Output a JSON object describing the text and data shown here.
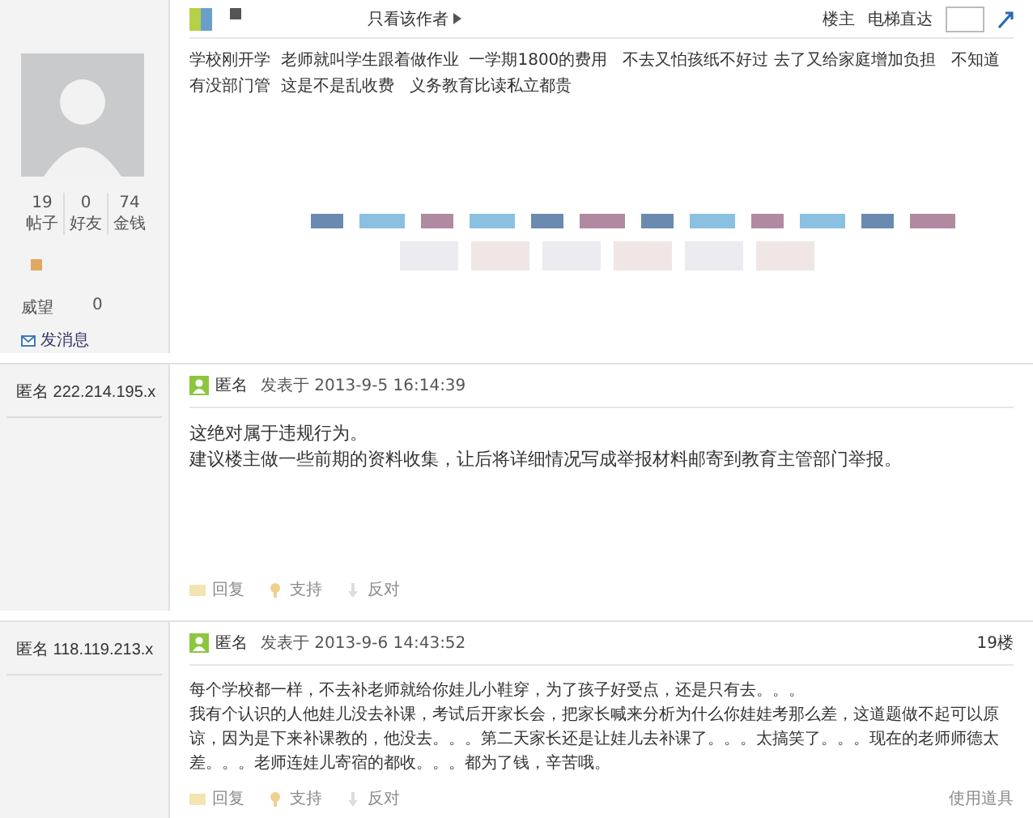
{
  "posts": [
    {
      "kind": "author",
      "author": {
        "stats": [
          {
            "value": "19",
            "label": "帖子"
          },
          {
            "value": "0",
            "label": "好友"
          },
          {
            "value": "74",
            "label": "金钱"
          }
        ],
        "reputation": {
          "label": "威望",
          "value": "0"
        },
        "message_link": "发消息"
      },
      "header": {
        "only_author": "只看该作者",
        "floor": "楼主",
        "jump_label": "电梯直达"
      },
      "body": [
        "学校刚开学  老师就叫学生跟着做作业  一学期1800的费用   不去又怕孩纸不好过 去了又给家庭增加负担   不知道有没部门管  这是不是乱收费   义务教育比读私立都贵"
      ]
    },
    {
      "kind": "anonymous",
      "user_label": "匿名 222.214.195.x",
      "header": {
        "name": "匿名",
        "posted": "发表于 2013-9-5 16:14:39"
      },
      "body": [
        "这绝对属于违规行为。",
        "建议楼主做一些前期的资料收集，让后将详细情况写成举报材料邮寄到教育主管部门举报。"
      ],
      "actions": [
        "回复",
        "支持",
        "反对"
      ]
    },
    {
      "kind": "anonymous",
      "user_label": "匿名 118.119.213.x",
      "header": {
        "name": "匿名",
        "posted": "发表于 2013-9-6 14:43:52",
        "floor": "19楼"
      },
      "body": [
        "每个学校都一样，不去补老师就给你娃儿小鞋穿，为了孩子好受点，还是只有去。。。",
        "我有个认识的人他娃儿没去补课，考试后开家长会，把家长喊来分析为什么你娃娃考那么差，这道题做不起可以原谅，因为是下来补课教的，他没去。。。第二天家长还是让娃儿去补课了。。。太搞笑了。。。现在的老师师德太差。。。老师连娃儿寄宿的都收。。。都为了钱，辛苦哦。"
      ],
      "actions": [
        "回复",
        "支持",
        "反对"
      ],
      "tools": "使用道具"
    }
  ]
}
